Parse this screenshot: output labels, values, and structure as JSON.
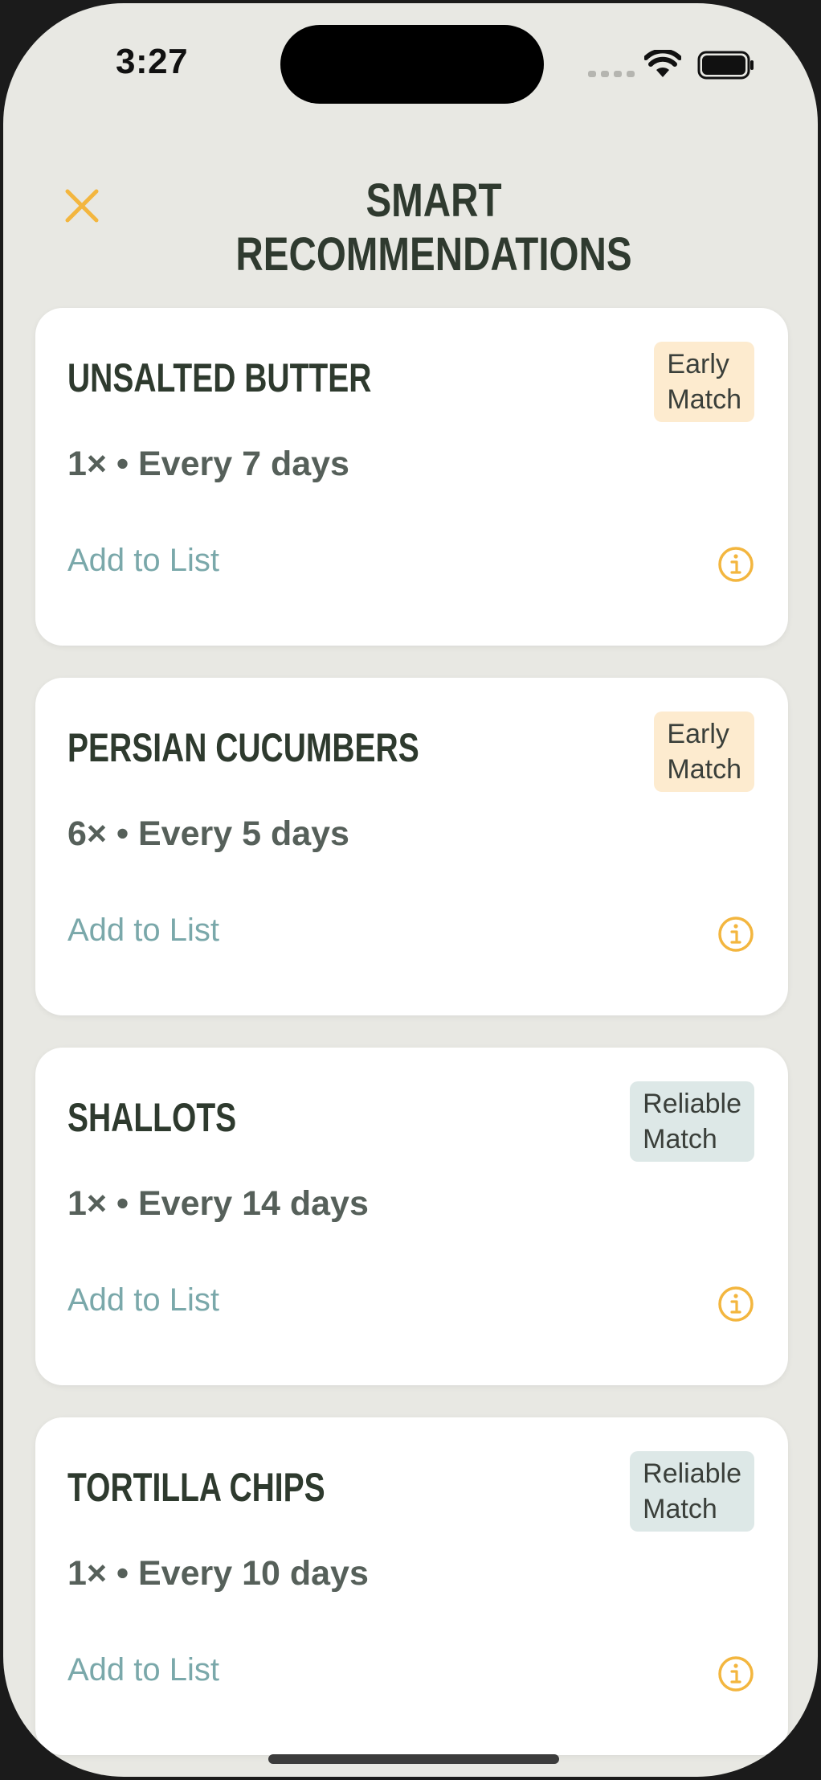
{
  "status_bar": {
    "time": "3:27"
  },
  "header": {
    "title": "SMART RECOMMENDATIONS",
    "close_icon": "close-x-icon",
    "accent_color": "#f3b63f"
  },
  "recommendations": [
    {
      "name": "UNSALTED BUTTER",
      "badge_line1": "Early",
      "badge_line2": "Match",
      "badge_type": "early",
      "frequency": "1× • Every 7 days",
      "action": "Add to List"
    },
    {
      "name": "PERSIAN CUCUMBERS",
      "badge_line1": "Early",
      "badge_line2": "Match",
      "badge_type": "early",
      "frequency": "6× • Every 5 days",
      "action": "Add to List"
    },
    {
      "name": "SHALLOTS",
      "badge_line1": "Reliable",
      "badge_line2": "Match",
      "badge_type": "reliable",
      "frequency": "1× • Every 14 days",
      "action": "Add to List"
    },
    {
      "name": "TORTILLA CHIPS",
      "badge_line1": "Reliable",
      "badge_line2": "Match",
      "badge_type": "reliable",
      "frequency": "1× • Every 10 days",
      "action": "Add to List"
    }
  ],
  "colors": {
    "background": "#e8e8e3",
    "card": "#ffffff",
    "early_badge": "#fdebcf",
    "reliable_badge": "#dde8e7",
    "link": "#7aa8aa",
    "title": "#2f3a2f"
  }
}
